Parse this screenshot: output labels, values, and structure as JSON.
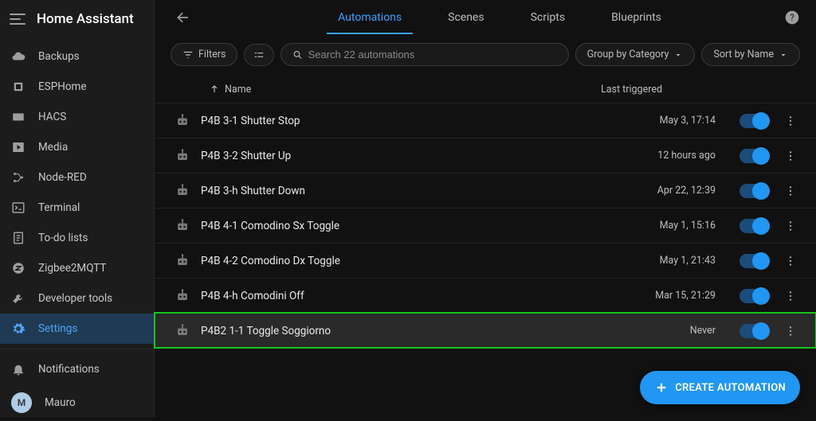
{
  "app": {
    "title": "Home Assistant"
  },
  "sidebar": {
    "items": [
      {
        "name": "backups",
        "icon": "cloud",
        "label": "Backups"
      },
      {
        "name": "esphome",
        "icon": "chip",
        "label": "ESPHome"
      },
      {
        "name": "hacs",
        "icon": "hacs",
        "label": "HACS"
      },
      {
        "name": "media",
        "icon": "media",
        "label": "Media"
      },
      {
        "name": "nodered",
        "icon": "nodes",
        "label": "Node-RED"
      },
      {
        "name": "terminal",
        "icon": "terminal",
        "label": "Terminal"
      },
      {
        "name": "todo",
        "icon": "todo",
        "label": "To-do lists"
      },
      {
        "name": "z2m",
        "icon": "zigbee",
        "label": "Zigbee2MQTT"
      },
      {
        "name": "devtools",
        "icon": "wrench",
        "label": "Developer tools"
      },
      {
        "name": "settings",
        "icon": "gear",
        "label": "Settings",
        "active": true
      }
    ],
    "bottom": [
      {
        "name": "notifications",
        "icon": "bell",
        "label": "Notifications"
      }
    ],
    "user": {
      "initial": "M",
      "name": "Mauro"
    }
  },
  "tabs": {
    "items": [
      {
        "label": "Automations",
        "active": true
      },
      {
        "label": "Scenes"
      },
      {
        "label": "Scripts"
      },
      {
        "label": "Blueprints"
      }
    ]
  },
  "toolbar": {
    "filters_label": "Filters",
    "search_placeholder": "Search 22 automations",
    "group_label": "Group by Category",
    "sort_label": "Sort by Name"
  },
  "table": {
    "col_name": "Name",
    "col_triggered": "Last triggered"
  },
  "automations": [
    {
      "name": "P4B 3-1 Shutter Stop",
      "triggered": "May 3, 17:14",
      "on": true
    },
    {
      "name": "P4B 3-2 Shutter Up",
      "triggered": "12 hours ago",
      "on": true
    },
    {
      "name": "P4B 3-h Shutter Down",
      "triggered": "Apr 22, 12:39",
      "on": true
    },
    {
      "name": "P4B 4-1 Comodino Sx Toggle",
      "triggered": "May 1, 15:16",
      "on": true
    },
    {
      "name": "P4B 4-2 Comodino Dx Toggle",
      "triggered": "May 1, 21:43",
      "on": true
    },
    {
      "name": "P4B 4-h Comodini Off",
      "triggered": "Mar 15, 21:29",
      "on": true
    },
    {
      "name": "P4B2 1-1 Toggle Soggiorno",
      "triggered": "Never",
      "on": true,
      "highlight": true
    }
  ],
  "fab": {
    "label": "CREATE AUTOMATION"
  }
}
